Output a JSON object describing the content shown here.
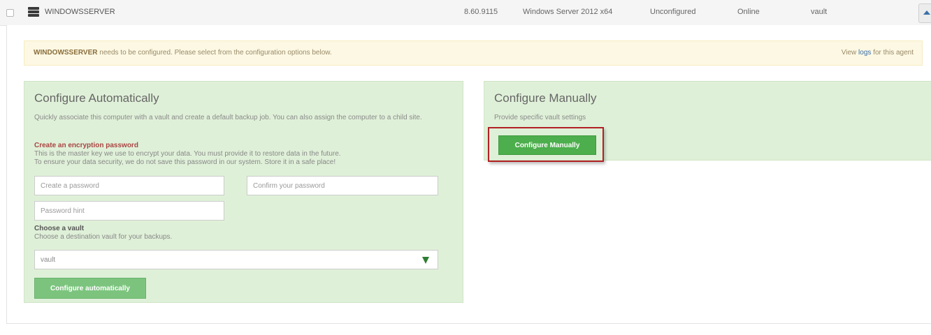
{
  "agent_row": {
    "name": "WINDOWSSERVER",
    "version": "8.60.9115",
    "os": "Windows Server 2012 x64",
    "config_status": "Unconfigured",
    "online_status": "Online",
    "vault": "vault",
    "icons": {
      "server": "server-icon",
      "expand": "chevron-up-icon"
    }
  },
  "alert": {
    "agent_name": "WINDOWSSERVER",
    "message": "needs to be configured. Please select from the configuration options below.",
    "view_prefix": "View",
    "logs_link": "logs",
    "view_suffix": "for this agent"
  },
  "configure_auto": {
    "title": "Configure Automatically",
    "description": "Quickly associate this computer with a vault and create a default backup job. You can also assign the computer to a child site.",
    "encryption_heading": "Create an encryption password",
    "encryption_line1": "This is the master key we use to encrypt your data. You must provide it to restore data in the future.",
    "encryption_line2": "To ensure your data security, we do not save this password in our system. Store it in a safe place!",
    "password_placeholder": "Create a password",
    "confirm_placeholder": "Confirm your password",
    "hint_placeholder": "Password hint",
    "vault_heading": "Choose a vault",
    "vault_text": "Choose a destination vault for your backups.",
    "vault_selected": "vault",
    "button_label": "Configure automatically"
  },
  "configure_manual": {
    "title": "Configure Manually",
    "description": "Provide specific vault settings",
    "button_label": "Configure Manually"
  },
  "colors": {
    "panel_bg": "#dff0d8",
    "alert_bg": "#fcf8e3",
    "primary_green": "#4cae4c",
    "highlight_red": "#b22024"
  }
}
